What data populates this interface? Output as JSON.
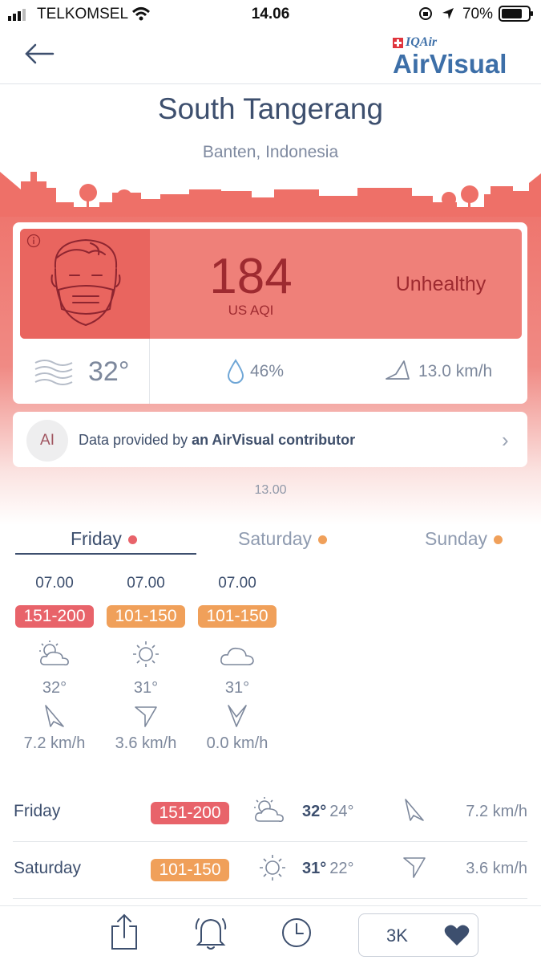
{
  "status_bar": {
    "carrier": "TELKOMSEL",
    "time": "14.06",
    "battery": "70%"
  },
  "header": {
    "logo_brand": "IQAir",
    "logo_app": "AirVisual"
  },
  "location": {
    "city": "South Tangerang",
    "region": "Banten, Indonesia"
  },
  "aqi": {
    "value": "184",
    "unit": "US AQI",
    "status": "Unhealthy"
  },
  "weather": {
    "temperature": "32°",
    "humidity": "46%",
    "wind": "13.0 km/h"
  },
  "source": {
    "initials": "AI",
    "text_prefix": "Data provided by ",
    "text_bold": "an AirVisual contributor"
  },
  "updated_time": "13.00",
  "colors": {
    "unhealthy": "#e8636a",
    "sensitive": "#f0a05a",
    "header_pink": "#ee7068"
  },
  "tabs": [
    {
      "label": "Friday",
      "dot_color": "#e8636a"
    },
    {
      "label": "Saturday",
      "dot_color": "#f0a05a"
    },
    {
      "label": "Sunday",
      "dot_color": "#f0a05a"
    }
  ],
  "hourly": [
    {
      "time": "07.00",
      "aqi_range": "151-200",
      "color": "#e8636a",
      "icon": "partly-cloudy-icon",
      "temp": "32°",
      "wind": "7.2 km/h"
    },
    {
      "time": "07.00",
      "aqi_range": "101-150",
      "color": "#f0a05a",
      "icon": "sun-icon",
      "temp": "31°",
      "wind": "3.6 km/h"
    },
    {
      "time": "07.00",
      "aqi_range": "101-150",
      "color": "#f0a05a",
      "icon": "cloud-icon",
      "temp": "31°",
      "wind": "0.0 km/h"
    }
  ],
  "daily": [
    {
      "day": "Friday",
      "aqi_range": "151-200",
      "color": "#e8636a",
      "icon": "partly-cloudy-icon",
      "high": "32°",
      "low": "24°",
      "wind": "7.2 km/h"
    },
    {
      "day": "Saturday",
      "aqi_range": "101-150",
      "color": "#f0a05a",
      "icon": "sun-icon",
      "high": "31°",
      "low": "22°",
      "wind": "3.6 km/h"
    }
  ],
  "bottom_bar": {
    "favorite_count": "3K"
  }
}
